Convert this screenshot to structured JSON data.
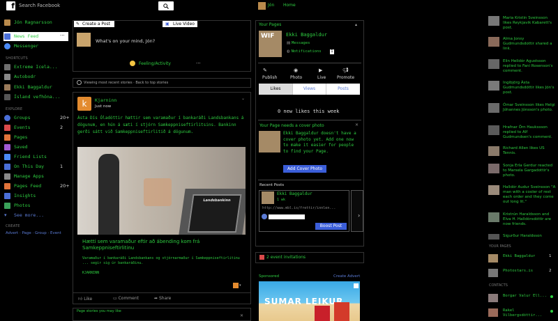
{
  "topbar": {
    "logo": "f",
    "search_placeholder": "Search Facebook",
    "user_name": "Jón",
    "home": "Home"
  },
  "sidebar": {
    "profile_name": "Jón Ragnarsson",
    "main_items": [
      {
        "label": "News Feed"
      },
      {
        "label": "Messenger"
      }
    ],
    "shortcuts_title": "SHORTCUTS",
    "shortcuts": [
      {
        "label": "Extreme Icela..."
      },
      {
        "label": "Autobodr"
      },
      {
        "label": "Ekki Baggaldur"
      },
      {
        "label": "Ísland vefhöna..."
      }
    ],
    "explore_title": "EXPLORE",
    "explore": [
      {
        "label": "Groups",
        "count": "20+"
      },
      {
        "label": "Events",
        "count": "2"
      },
      {
        "label": "Pages",
        "count": ""
      },
      {
        "label": "Saved",
        "count": ""
      },
      {
        "label": "Friend Lists",
        "count": ""
      },
      {
        "label": "On This Day",
        "count": "1"
      },
      {
        "label": "Manage Apps",
        "count": ""
      },
      {
        "label": "Pages Feed",
        "count": "20+"
      },
      {
        "label": "Insights",
        "count": ""
      },
      {
        "label": "Photos",
        "count": ""
      },
      {
        "label": "See more...",
        "count": ""
      }
    ],
    "create_title": "CREATE",
    "create_links": "Advert · Page · Group · Event"
  },
  "composer": {
    "tab_create": "Create a Post",
    "tab_live": "Live Video",
    "prompt": "What's on your mind, Jón?",
    "feeling": "Feeling/Activity",
    "more": "···"
  },
  "feed_notice": "Viewing most recent stories · Back to top stories",
  "post": {
    "author": "Kjarninn",
    "time": "Just now",
    "body": "Ásta Dís Óladóttir hættir sem varamaður í bankaráði Landsbankans á dögunum, en hún á sæti í stjórn Samkeppniseftirlitsins. Bankinn gerði sátt við Samkeppniseftirlitið á dögunum.",
    "image_sign": "Landsbankinn",
    "link_title": "Hætti sem varamaður eftir að ábending kom frá Samkeppniseftirlitinu",
    "link_desc": "Varamaður í bankaráði Landsbankans og stjórnarmaður í Samkeppniseftirlitinu ... segir sig úr bankaráðinu.",
    "link_domain": "KJARNINN",
    "actions": [
      "Like",
      "Comment",
      "Share"
    ]
  },
  "page_stories": "Page stories you may like",
  "pages_panel": {
    "title": "Your Pages",
    "page_name": "Ekki Baggaldur",
    "messages": "Messages",
    "notifications": "Notifications",
    "badge": "1",
    "actions": [
      "Publish",
      "Photo",
      "Live",
      "Promote"
    ],
    "tabs": [
      "Likes",
      "Views",
      "Posts"
    ],
    "new_likes": "0 new likes this week",
    "cover_title": "Your Page needs a cover photo",
    "cover_text": "Ekki Baggaldur doesn't have a cover photo yet. Add one now to make it easier for people to find your Page.",
    "cover_button": "Add Cover Photo",
    "recent_posts": "Recent Posts",
    "recent_name": "Ekki Baggaldur",
    "recent_time": "1 wk",
    "recent_link": "http://www.mbl.is/frettir/innlen...",
    "boost": "Boost Post"
  },
  "invitations": "2 event invitations",
  "sponsored": {
    "label": "Sponsored",
    "create_advert": "Create Advert",
    "ad_text": "SUMAR LEIKUR"
  },
  "ticker": [
    {
      "text": "Maria Kristin Sveinsson likes Reykjavik Kabarett's post."
    },
    {
      "text": "Alma Jonsy Gudmundsdottir shared a link."
    },
    {
      "text": "Elin Helldór Agustsson replied to Fani Rosenson's comment."
    },
    {
      "text": "Ingibjörg Ásta Gudmundsdóttir likes Jón's post."
    },
    {
      "text": "Ómar Sveinsson likes Helgi Jóhannes Jónsson's photo."
    },
    {
      "text": "Hrafnar Örn Haukssson replied to Alf Gudmundsen's comment."
    },
    {
      "text": "Richard Allen likes US Tennis."
    },
    {
      "text": "Sonja Erla Gerdur reacted to Marsela Gargadottir's photo."
    },
    {
      "text": "Halldór Audur Sveinsson \"A man with a cooler of rest each order and they come out long lit.\""
    },
    {
      "text": "Kristrún Haraldsson and Elva H. Halldórsdóttir are now friends."
    },
    {
      "text": "Sigurður Haraldsson"
    }
  ],
  "your_pages_title": "YOUR PAGES",
  "your_pages": [
    {
      "name": "Ekki Baggaldur",
      "count": "1"
    },
    {
      "name": "Photostars.is",
      "count": "2"
    }
  ],
  "contacts_title": "CONTACTS",
  "contacts": [
    {
      "name": "Borgar Valur Ell..."
    },
    {
      "name": "Rakel Vilbergsdóttir..."
    }
  ],
  "colors": {
    "accent_green": "#2ecc40",
    "link_blue": "#5b7bd5",
    "button_blue": "#3b5ed9"
  }
}
